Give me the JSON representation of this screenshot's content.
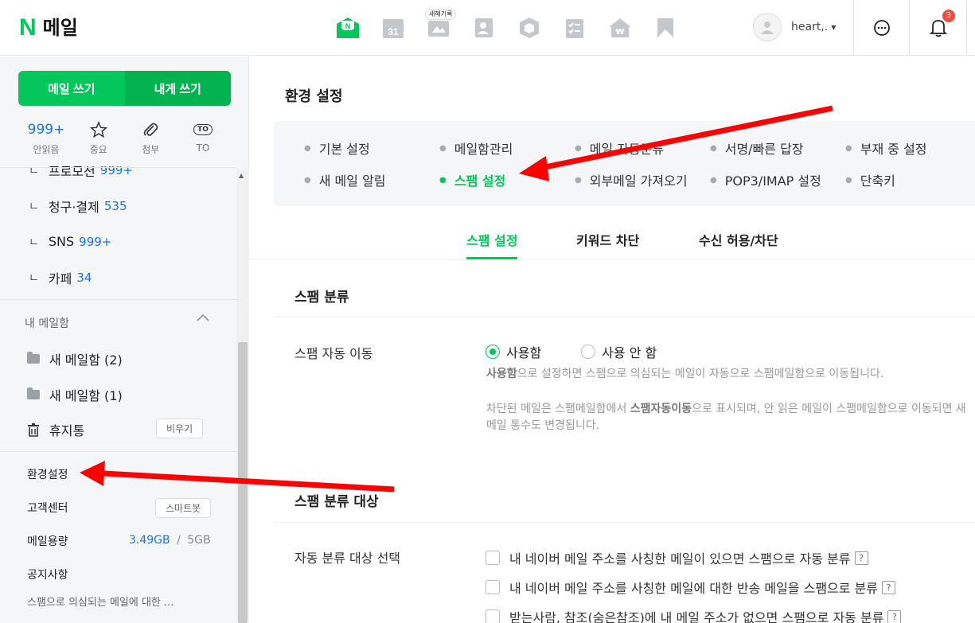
{
  "header": {
    "logo_mark": "N",
    "logo_text": "메일",
    "app_badge": "새해기록",
    "calendar_day": "31",
    "username": "heart,.",
    "notification_count": "3"
  },
  "sidebar": {
    "compose_label": "메일 쓰기",
    "self_compose_label": "내게 쓰기",
    "quick": [
      {
        "value": "999+",
        "label": "안읽음"
      },
      {
        "label": "중요"
      },
      {
        "label": "첨부"
      },
      {
        "icon_text": "TO",
        "label": "TO"
      }
    ],
    "folders": [
      {
        "name": "프로모션",
        "count": "999+"
      },
      {
        "name": "청구·결제",
        "count": "535"
      },
      {
        "name": "SNS",
        "count": "999+"
      },
      {
        "name": "카페",
        "count": "34"
      }
    ],
    "branch_mark": "ㄴ",
    "my_mailbox_title": "내 메일함",
    "my_folders": [
      "새 메일함 (2)",
      "새 메일함 (1)"
    ],
    "trash_label": "휴지통",
    "empty_trash_label": "비우기",
    "settings_label": "환경설정",
    "support_label": "고객센터",
    "smartbot_label": "스마트봇",
    "storage_label": "메일용량",
    "storage_used": "3.49GB",
    "storage_sep": "/",
    "storage_total": "5GB",
    "notice_label": "공지사항",
    "notice_text": "스팸으로 의심되는 메일에 대한 ..."
  },
  "main": {
    "title": "환경 설정",
    "menu": [
      [
        "기본 설정",
        "메일함관리",
        "메일 자동분류",
        "서명/빠른 답장",
        "부재 중 설정"
      ],
      [
        "새 메일 알림",
        "스팸 설정",
        "외부메일 가져오기",
        "POP3/IMAP 설정",
        "단축키"
      ]
    ],
    "tabs": [
      "스팸 설정",
      "키워드 차단",
      "수신 허용/차단"
    ],
    "section1_title": "스팸 분류",
    "auto_move_label": "스팸 자동 이동",
    "radio_on": "사용함",
    "radio_off": "사용 안 함",
    "desc1_bold": "사용함",
    "desc1_rest": "으로 설정하면 스팸으로 의심되는 메일이 자동으로 스팸메일함으로 이동됩니다.",
    "desc2_pre": "차단된 메일은 스팸메일함에서 ",
    "desc2_bold": "스팸자동이동",
    "desc2_rest": "으로 표시되며, 안 읽은 메일이 스팸메일함으로 이동되면 새 메일 통수도 변경됩니다.",
    "section2_title": "스팸 분류 대상",
    "target_label": "자동 분류 대상 선택",
    "options": [
      "내 네이버 메일 주소를 사칭한 메일이 있으면 스팸으로 자동 분류",
      "내 네이버 메일 주소를 사칭한 메일에 대한 반송 메일을 스팸으로 분류",
      "받는사람, 참조(숨은참조)에 내 메일 주소가 없으면 스팸으로 자동 분류"
    ],
    "help_mark": "?"
  }
}
